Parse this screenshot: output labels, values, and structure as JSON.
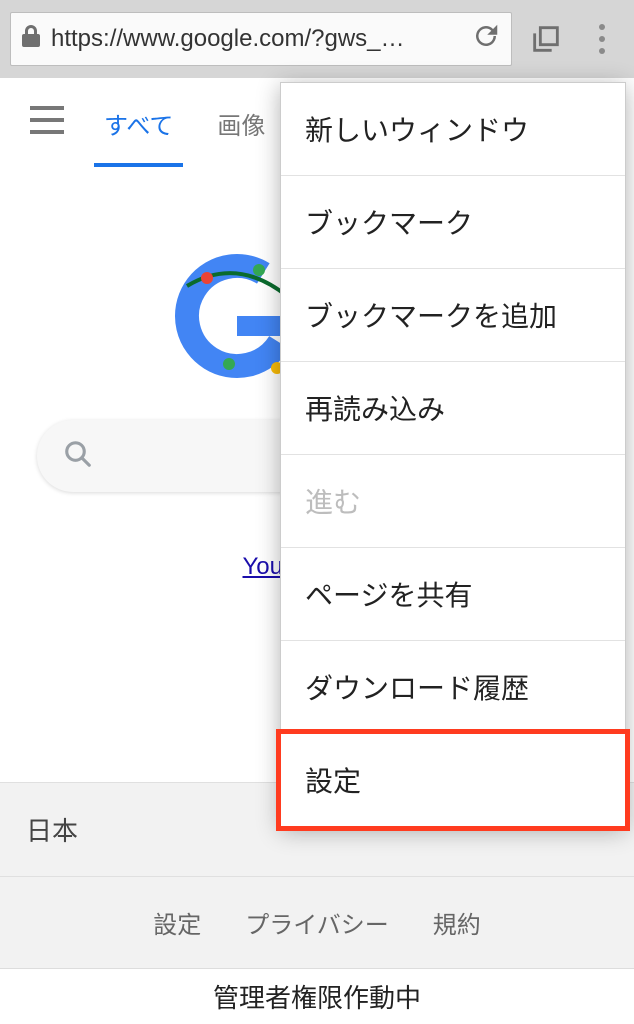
{
  "chrome": {
    "url": "https://www.google.com/?gws_…"
  },
  "tabs": {
    "all": "すべて",
    "images": "画像"
  },
  "quick_link": "YouTube と…",
  "footer": {
    "country": "日本",
    "settings": "設定",
    "privacy": "プライバシー",
    "terms": "規約"
  },
  "admin_banner": "管理者権限作動中",
  "menu": {
    "new_window": "新しいウィンドウ",
    "bookmarks": "ブックマーク",
    "add_bookmark": "ブックマークを追加",
    "reload": "再読み込み",
    "forward": "進む",
    "share": "ページを共有",
    "downloads": "ダウンロード履歴",
    "settings": "設定"
  }
}
